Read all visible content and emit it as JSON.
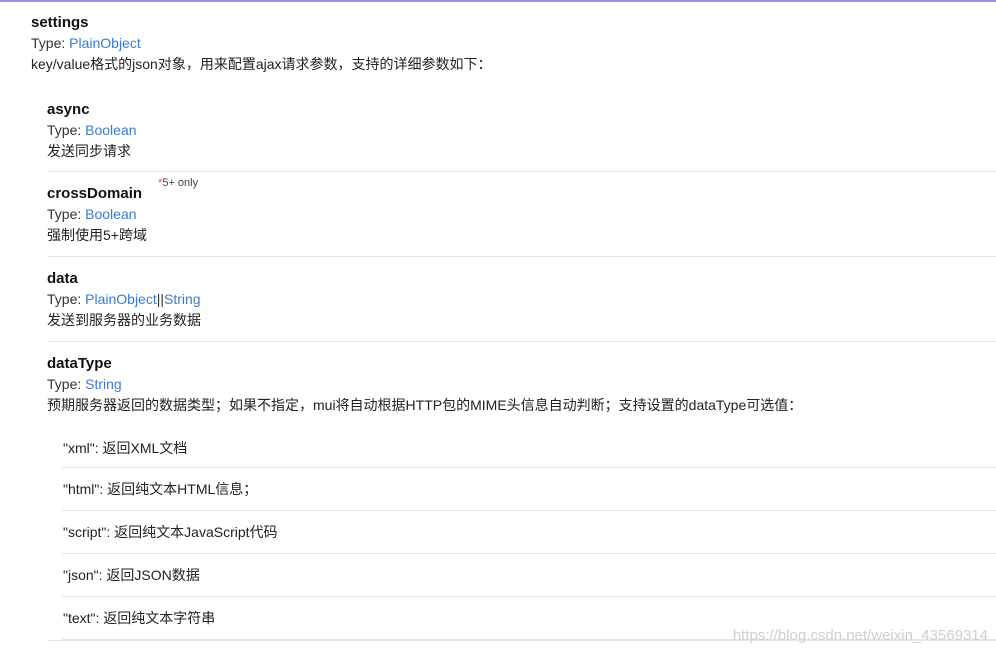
{
  "settings": {
    "name": "settings",
    "type_prefix": "Type: ",
    "type": "PlainObject",
    "description": "key/value格式的json对象，用来配置ajax请求参数，支持的详细参数如下："
  },
  "params": {
    "async": {
      "name": "async",
      "type_prefix": "Type: ",
      "type": "Boolean",
      "description": "发送同步请求"
    },
    "crossDomain": {
      "name": "crossDomain",
      "badge_star": "*",
      "badge_text": "5+ only",
      "type_prefix": "Type: ",
      "type": "Boolean",
      "description": "强制使用5+跨域"
    },
    "data": {
      "name": "data",
      "type_prefix": "Type: ",
      "type_a": "PlainObject",
      "type_sep": "||",
      "type_b": "String",
      "description": "发送到服务器的业务数据"
    },
    "dataType": {
      "name": "dataType",
      "type_prefix": "Type: ",
      "type": "String",
      "description": "预期服务器返回的数据类型；如果不指定，mui将自动根据HTTP包的MIME头信息自动判断；支持设置的dataType可选值：",
      "options": [
        "\"xml\": 返回XML文档",
        "\"html\": 返回纯文本HTML信息；",
        "\"script\": 返回纯文本JavaScript代码",
        "\"json\": 返回JSON数据",
        "\"text\": 返回纯文本字符串"
      ]
    }
  },
  "watermark": "https://blog.csdn.net/weixin_43569314",
  "colors": {
    "link": "#3a7bd5",
    "top_border": "#9b8cf0",
    "badge_star": "#e05a3a"
  }
}
